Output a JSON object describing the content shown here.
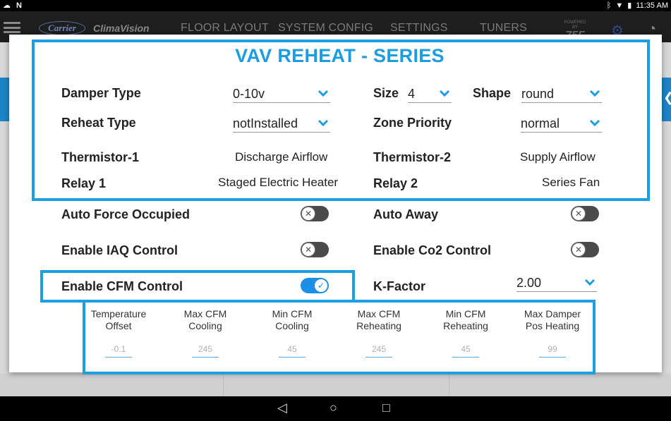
{
  "status_bar": {
    "time": "11:35 AM"
  },
  "app_header": {
    "brand_carrier": "Carrier",
    "brand_product": "ClimaVision",
    "nav": [
      "FLOOR LAYOUT",
      "SYSTEM CONFIG",
      "SETTINGS",
      "TUNERS"
    ],
    "powered_by": "POWERED BY",
    "powered_logo": "75F"
  },
  "dialog": {
    "title": "VAV REHEAT - SERIES",
    "damper_type": {
      "label": "Damper Type",
      "value": "0-10v"
    },
    "size": {
      "label": "Size",
      "value": "4"
    },
    "shape": {
      "label": "Shape",
      "value": "round"
    },
    "reheat_type": {
      "label": "Reheat Type",
      "value": "notInstalled"
    },
    "zone_priority": {
      "label": "Zone Priority",
      "value": "normal"
    },
    "thermistor_1": {
      "label": "Thermistor-1",
      "value": "Discharge Airflow"
    },
    "thermistor_2": {
      "label": "Thermistor-2",
      "value": "Supply Airflow"
    },
    "relay_1": {
      "label": "Relay 1",
      "value": "Staged Electric Heater"
    },
    "relay_2": {
      "label": "Relay 2",
      "value": "Series Fan"
    },
    "auto_force_occupied": {
      "label": "Auto Force Occupied",
      "on": false
    },
    "auto_away": {
      "label": "Auto Away",
      "on": false
    },
    "enable_iaq": {
      "label": "Enable IAQ Control",
      "on": false
    },
    "enable_co2": {
      "label": "Enable Co2 Control",
      "on": false
    },
    "enable_cfm": {
      "label": "Enable CFM Control",
      "on": true
    },
    "k_factor": {
      "label": "K-Factor",
      "value": "2.00"
    },
    "cfm_table": [
      {
        "line1": "Temperature",
        "line2": "Offset",
        "value": "-0.1"
      },
      {
        "line1": "Max CFM",
        "line2": "Cooling",
        "value": "245"
      },
      {
        "line1": "Min CFM",
        "line2": "Cooling",
        "value": "45"
      },
      {
        "line1": "Max CFM",
        "line2": "Reheating",
        "value": "245"
      },
      {
        "line1": "Min CFM",
        "line2": "Reheating",
        "value": "45"
      },
      {
        "line1": "Max Damper",
        "line2": "Pos Heating",
        "value": "99"
      }
    ]
  },
  "colors": {
    "accent": "#1aa0e0",
    "toggle_on": "#1e8fe6",
    "toggle_off": "#4a4a4a"
  }
}
